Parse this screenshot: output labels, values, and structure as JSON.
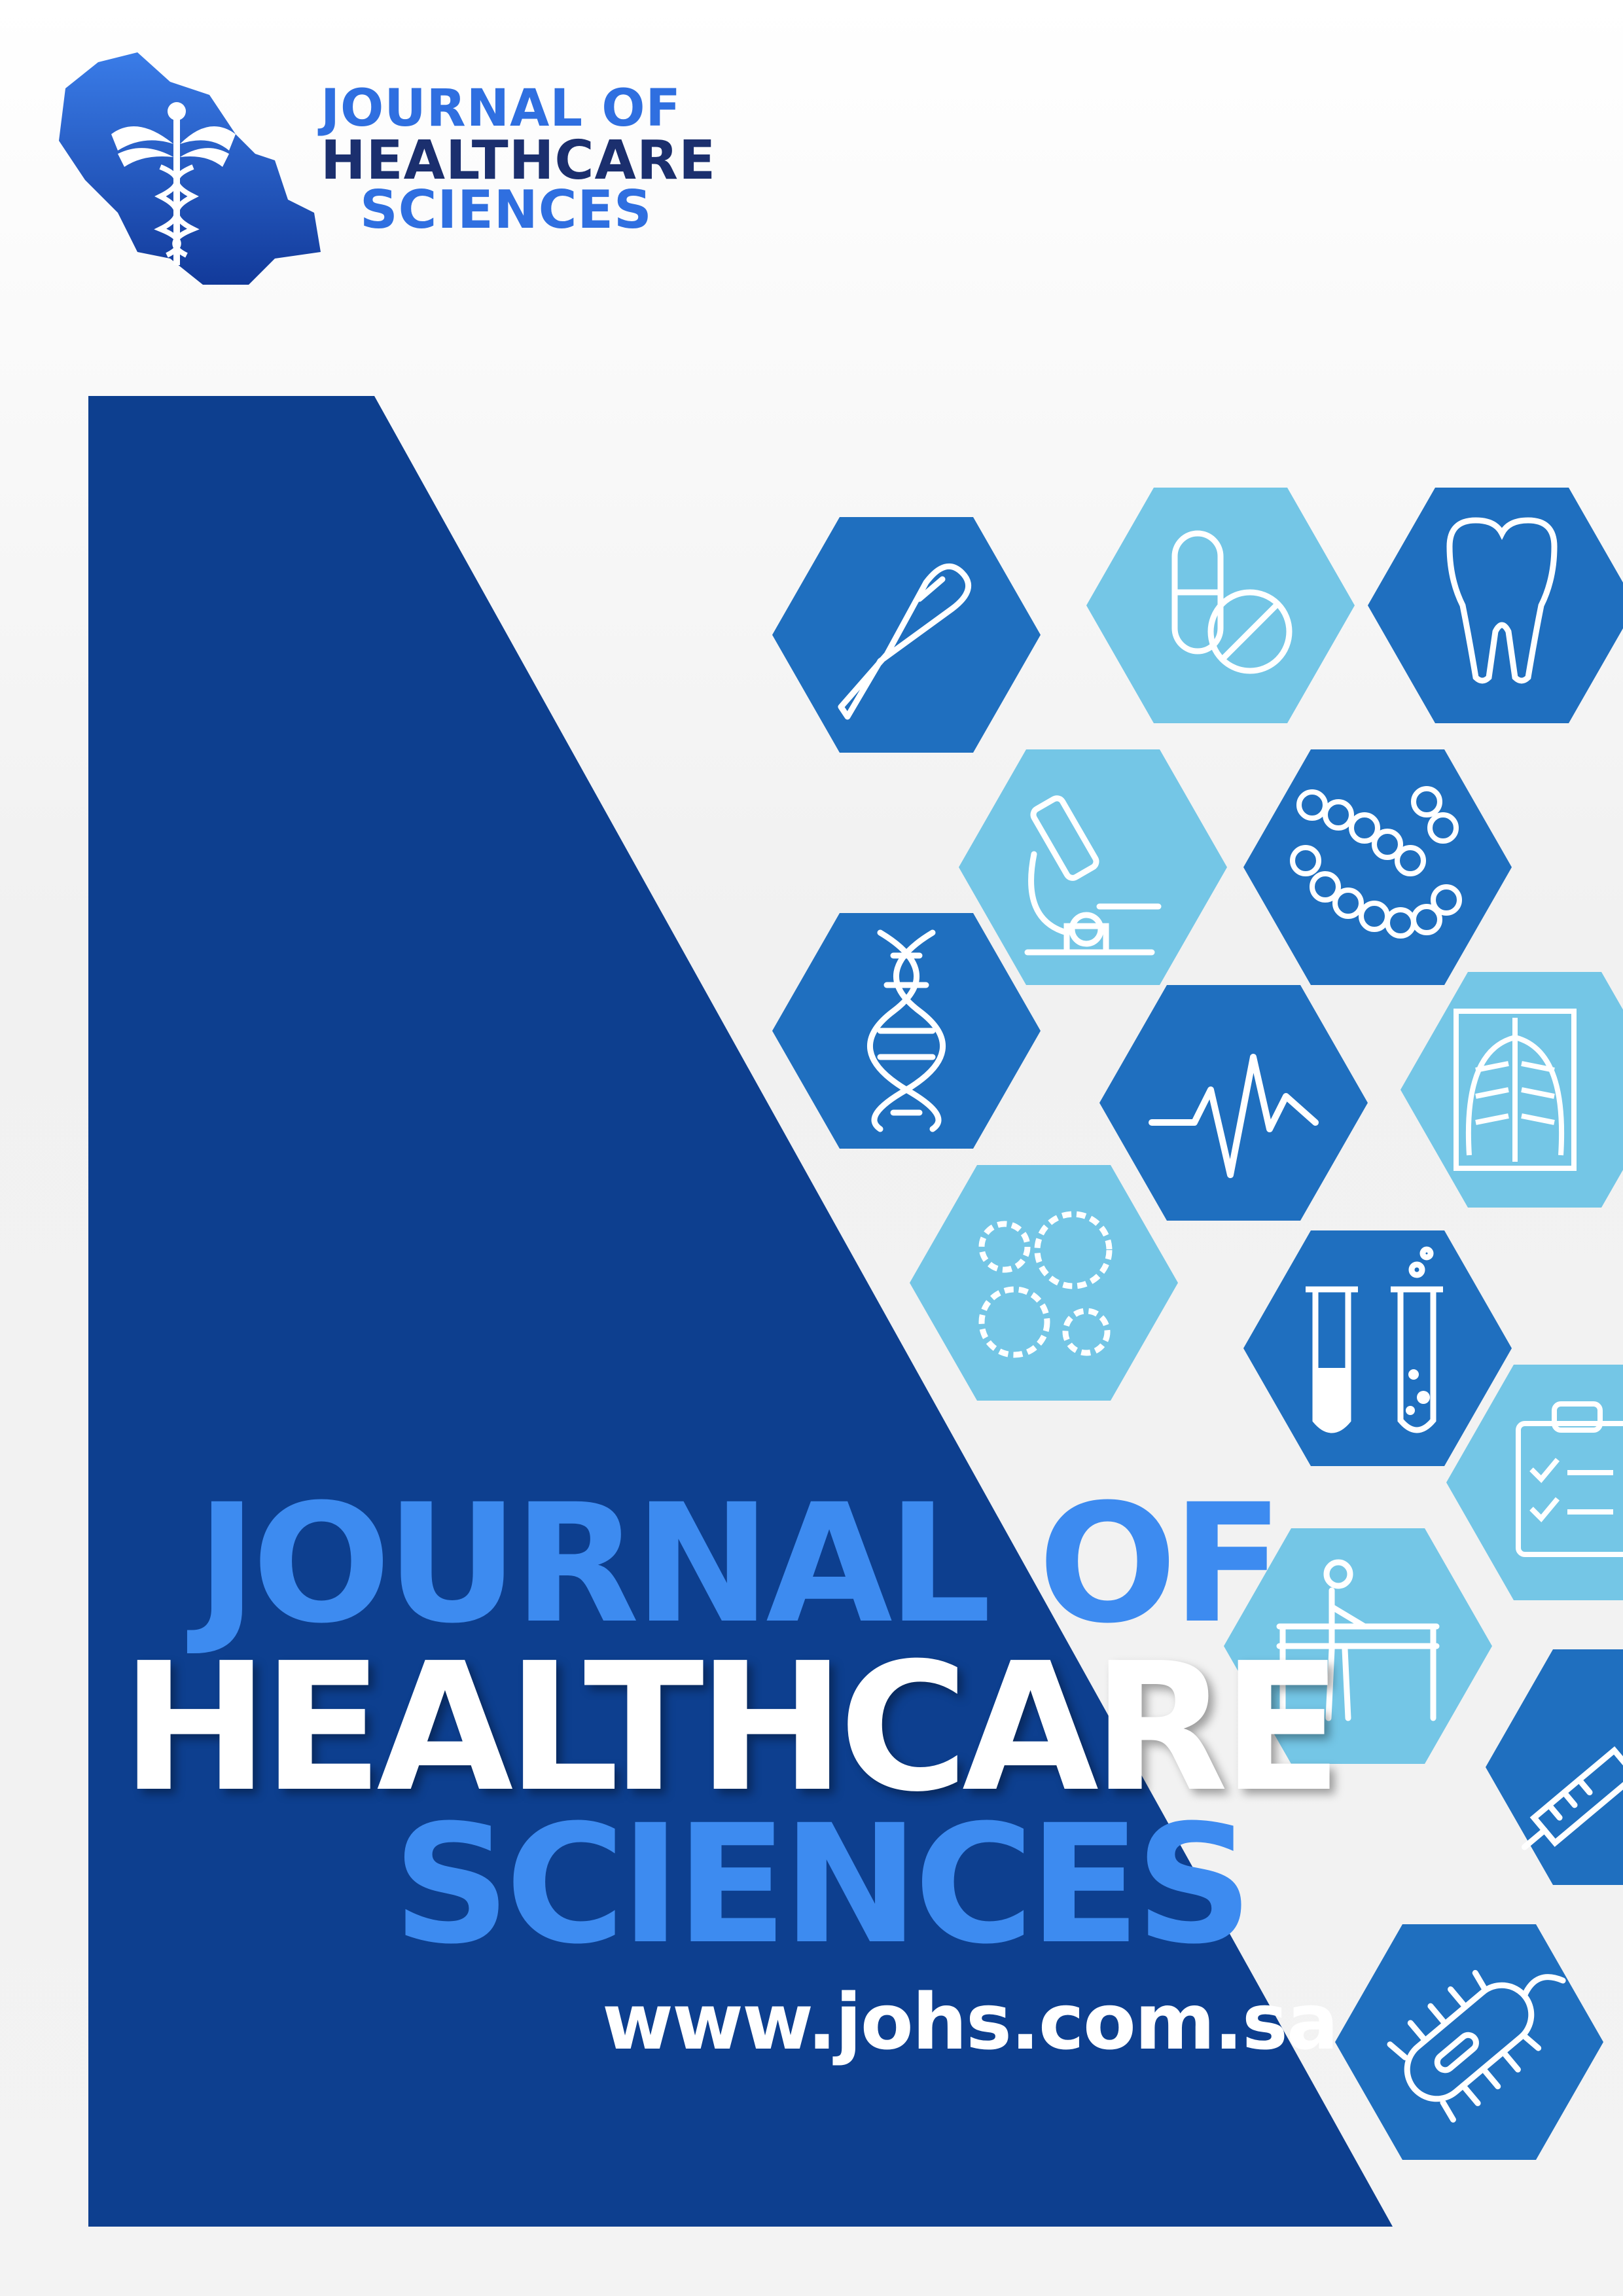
{
  "header": {
    "logo_lines": [
      "JOURNAL OF",
      "HEALTHCARE",
      "SCIENCES"
    ]
  },
  "cover": {
    "title_line1": "JOURNAL OF",
    "title_line2": "HEALTHCARE",
    "title_line3": "SCIENCES",
    "website": "www.johs.com.sa"
  },
  "icons": [
    "thermometer-icon",
    "pills-icon",
    "tooth-icon",
    "microscope-icon",
    "bacteria-chain-icon",
    "dna-icon",
    "heartbeat-icon",
    "xray-icon",
    "virus-icon",
    "test-tubes-icon",
    "clipboard-icon",
    "physiotherapy-icon",
    "syringe-icon",
    "bacterium-icon"
  ],
  "colors": {
    "navy": "#0d3f8f",
    "hex_dark": "#1f6fbf",
    "hex_light": "#74c6e6",
    "title_blue": "#3d8bf0",
    "logo_dark": "#1b2f6e"
  }
}
